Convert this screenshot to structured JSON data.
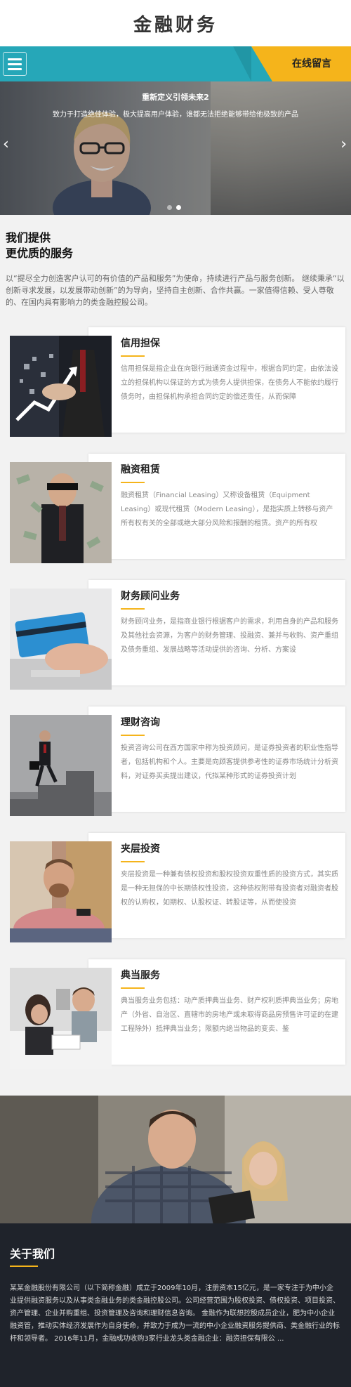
{
  "header": {
    "logo": "金融财务"
  },
  "nav": {
    "menu_icon": "hamburger-icon",
    "online_message": "在线留言"
  },
  "hero": {
    "title": "重新定义引领未来2",
    "subtitle": "致力于打造绝佳体验，极大提高用户体验，谁都无法拒绝能够带给他极致的产品",
    "prev_icon": "chevron-left-icon",
    "next_icon": "chevron-right-icon",
    "slides": 2,
    "active_slide": 2
  },
  "offer": {
    "title_line1": "我们提供",
    "title_line2": "更优质的服务",
    "intro": "以“提尽全力创造客户认可的有价值的产品和服务”为使命，持续进行产品与服务创新。 继续秉承“以创新寻求发展，以发展带动创新”的为导向，坚持自主创新、合作共赢。一家值得信赖、受人尊敬的、在国内具有影响力的类金融控股公司。"
  },
  "services": [
    {
      "title": "信用担保",
      "text": "信用担保是指企业在向银行融通资金过程中，根据合同约定，由依法设立的担保机构以保证的方式为债务人提供担保，在债务人不能依约履行债务时，由担保机构承担合同约定的偿还责任，从而保障"
    },
    {
      "title": "融资租赁",
      "text": "融资租赁（Financial Leasing）又称设备租赁（Equipment Leasing）或现代租赁（Modern Leasing），是指实质上转移与资产所有权有关的全部或绝大部分风险和报酬的租赁。资产的所有权"
    },
    {
      "title": "财务顾问业务",
      "text": "财务顾问业务，是指商业银行根据客户的需求，利用自身的产品和服务及其他社会资源，为客户的财务管理、投融资、兼并与收购、资产重组及债务重组、发展战略等活动提供的咨询、分析、方案设"
    },
    {
      "title": "理财咨询",
      "text": "投资咨询公司在西方国家中称为投资顾问，是证券投资者的职业性指导者，包括机构和个人。主要是向顾客提供参考性的证券市场统计分析资料，对证券买卖提出建议，代拟某种形式的证券投资计划"
    },
    {
      "title": "夹层投资",
      "text": "夹层投资是一种兼有债权投资和股权投资双重性质的投资方式，其实质是一种无担保的中长期债权性投资，这种债权附带有投资者对融资者股权的认购权，如期权、认股权证、转股证等，从而使投资"
    },
    {
      "title": "典当服务",
      "text": "典当服务业务包括：动产质押典当业务、财产权利质押典当业务；房地产（外省、自治区、直辖市的房地产或未取得商品房预售许可证的在建工程除外）抵押典当业务；限额内绝当物品的变卖、鉴"
    }
  ],
  "about": {
    "title": "关于我们",
    "text": "某某金融股份有限公司（以下简称金融）成立于2009年10月，注册资本15亿元，是一家专注于为中小企业提供融资服务以及从事类金融业务的类金融控股公司。公司经营范围为股权投资、债权投资、项目投资、资产管理、企业并购重组、投资管理及咨询和理财信息咨询。 金融作为联想控股成员企业，肥为中小企业融资管，推动实体经济发展作为自身使命，并致力于成为一流的中小企业融资服务提供商、类金融行业的标杆和领导者。 2016年11月，金融成功收购3家行业龙头类金融企业：融资担保有限公 ..."
  },
  "colors": {
    "teal": "#26a7b8",
    "yellow": "#f5b41b",
    "dark": "#1f232b"
  }
}
